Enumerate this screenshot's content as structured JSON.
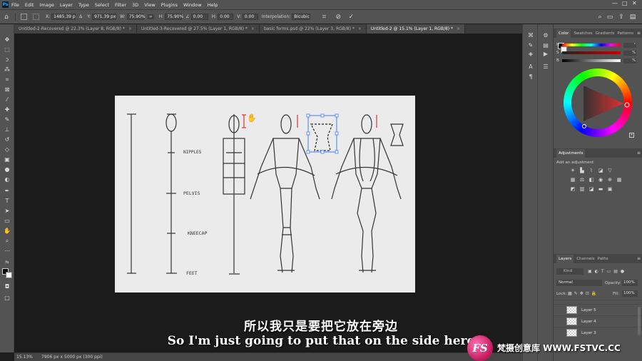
{
  "menubar": {
    "app_icon": "Ps",
    "items": [
      "File",
      "Edit",
      "Image",
      "Layer",
      "Type",
      "Select",
      "Filter",
      "3D",
      "View",
      "Plugins",
      "Window",
      "Help"
    ],
    "window_controls": [
      "—",
      "□",
      "✕"
    ]
  },
  "options": {
    "x_label": "X:",
    "x_value": "1485.39 p",
    "y_label": "Y:",
    "y_value": "971.39 px",
    "w_label": "W:",
    "w_value": "75.90%",
    "h_label": "H:",
    "h_value": "75.90%",
    "angle_value": "0.00",
    "hskew_label": "H:",
    "hskew_value": "0.00",
    "vskew_label": "V:",
    "vskew_value": "0.00",
    "interp_label": "Interpolation:",
    "interp_value": "Bicubic"
  },
  "tabs": [
    {
      "label": "Untitled-2-Recovered @ 22.3% (Layer 8, RGB/8) *"
    },
    {
      "label": "Untitled-3-Recovered @ 27.5% (Layer 1, RGB/8) *"
    },
    {
      "label": "basic forms.psd @ 22% (Layer 3, RGB/8) *"
    },
    {
      "label": "Untitled-2 @ 15.1% (Layer 1, RGB/8) *"
    }
  ],
  "drawing_labels": {
    "nipples": "NIPPLES",
    "pelvis": "PELVIS",
    "kneecap": "KNEECAP",
    "feet": "FEET"
  },
  "status": {
    "zoom": "15.13%",
    "doc_size": "7906 px x 5000 px (300 ppi)"
  },
  "color_panel": {
    "tabs": [
      "Color",
      "Swatches",
      "Gradients",
      "Patterns"
    ],
    "h_label": "H",
    "s_label": "S",
    "b_label": "B",
    "h_unit": "°",
    "s_unit": "%",
    "b_unit": "%"
  },
  "adjustments_panel": {
    "title": "Adjustments",
    "hint": "Add an adjustment"
  },
  "layers_panel": {
    "tabs": [
      "Layers",
      "Channels",
      "Paths"
    ],
    "kind_placeholder": "Kind",
    "blend_mode": "Normal",
    "opacity_label": "Opacity:",
    "opacity_value": "100%",
    "lock_label": "Lock:",
    "fill_label": "Fill:",
    "fill_value": "100%",
    "layers": [
      {
        "name": "Layer 5"
      },
      {
        "name": "Layer 4"
      },
      {
        "name": "Layer 3"
      }
    ]
  },
  "subtitles": {
    "chinese": "所以我只是要把它放在旁边",
    "english": "So I'm just going to put that on the side here"
  },
  "watermark": {
    "logo_text": "FS",
    "text": "梵摄创意库 WWW.FSTVC.CC"
  },
  "colors": {
    "accent_red": "#e0322f",
    "selection_blue": "#3d7cf5",
    "watermark_pink": "#d81b60"
  }
}
